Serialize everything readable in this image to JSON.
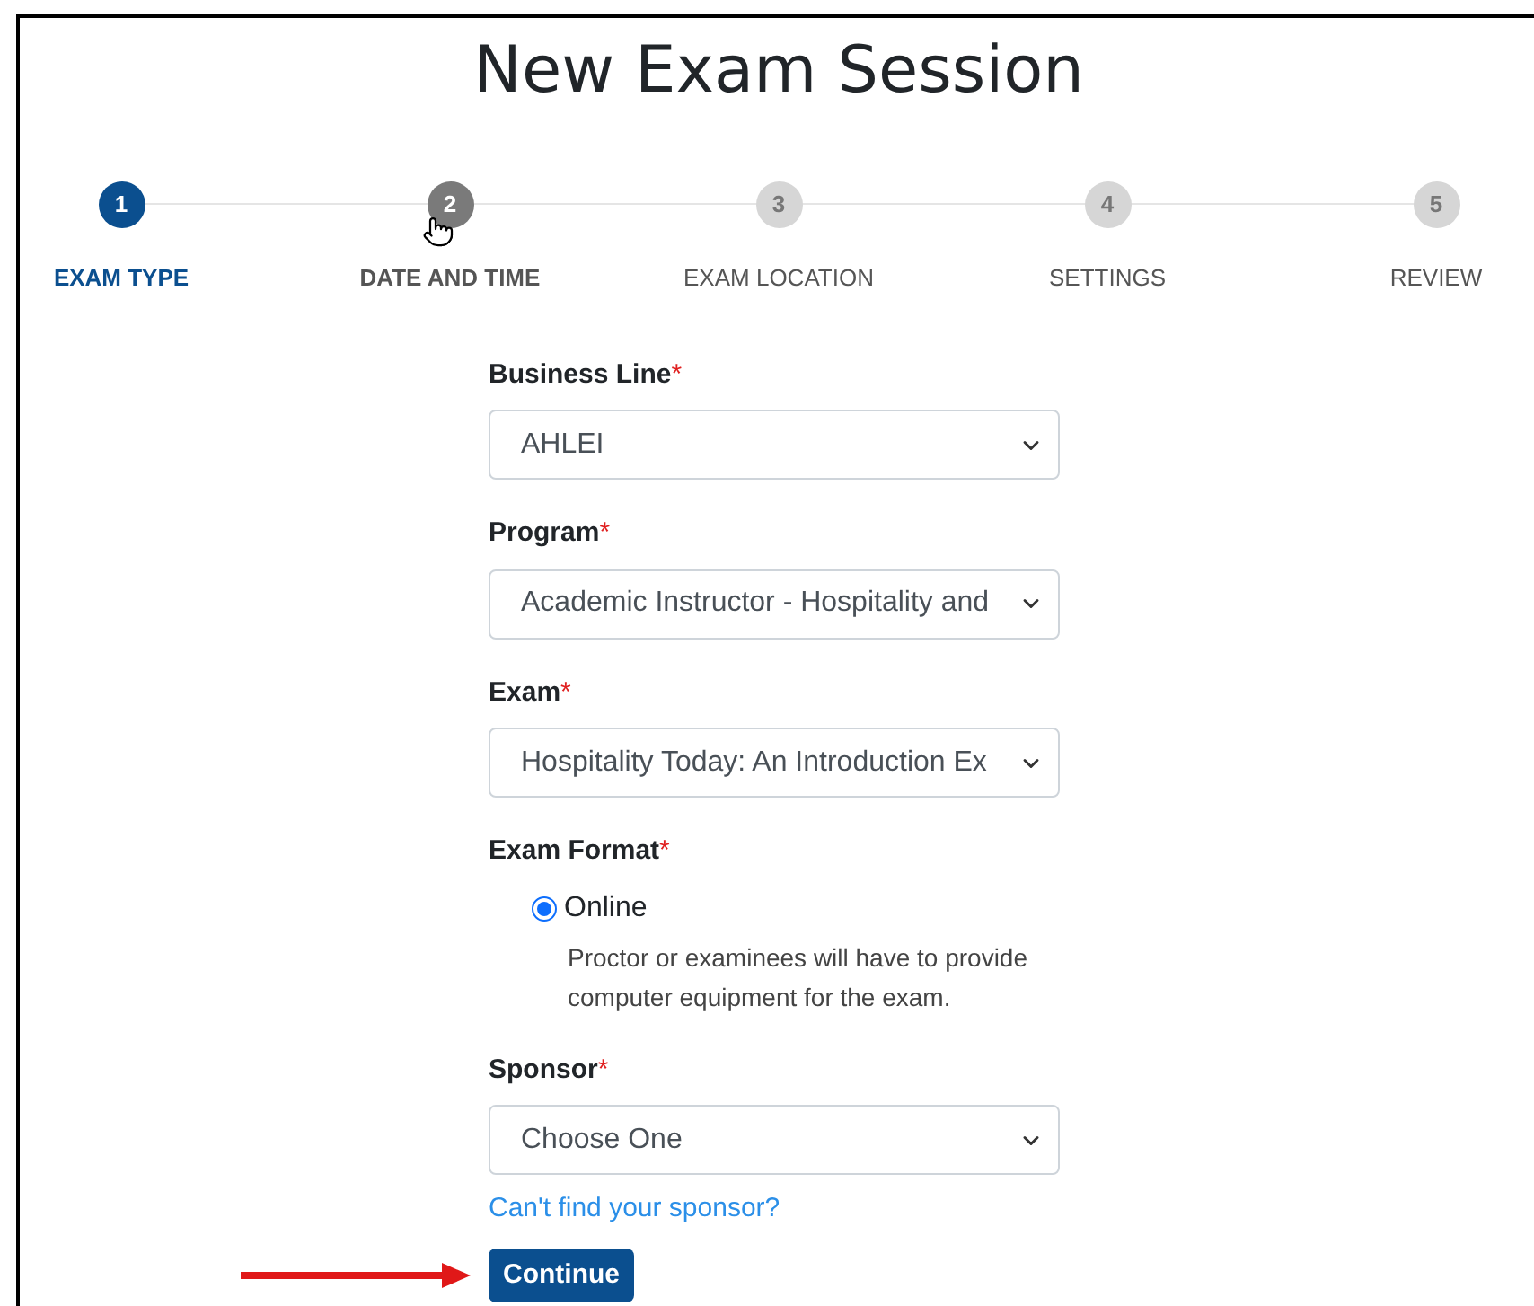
{
  "title": "New Exam Session",
  "steps": [
    {
      "number": "1",
      "label": "EXAM TYPE",
      "selected": true,
      "hovered": false
    },
    {
      "number": "2",
      "label": "DATE AND TIME",
      "selected": false,
      "hovered": true
    },
    {
      "number": "3",
      "label": "EXAM LOCATION",
      "selected": false,
      "hovered": false
    },
    {
      "number": "4",
      "label": "SETTINGS",
      "selected": false,
      "hovered": false
    },
    {
      "number": "5",
      "label": "REVIEW",
      "selected": false,
      "hovered": false
    }
  ],
  "fields": [
    {
      "kind": "select",
      "label": "Business Line",
      "required_mark": "*",
      "value": "AHLEI"
    },
    {
      "kind": "select",
      "label": "Program",
      "required_mark": "*",
      "value": "Academic Instructor - Hospitality and"
    },
    {
      "kind": "select",
      "label": "Exam",
      "required_mark": "*",
      "value": "Hospitality Today: An Introduction Ex"
    },
    {
      "kind": "radio",
      "label": "Exam Format",
      "required_mark": "*",
      "options": [
        {
          "label": "Online",
          "selected": true,
          "description": "Proctor or examinees will have to provide computer equipment for the exam."
        }
      ]
    },
    {
      "kind": "select",
      "label": "Sponsor",
      "required_mark": "*",
      "value": "Choose One",
      "link": "Can't find your sponsor?"
    }
  ],
  "continue_button": "Continue"
}
